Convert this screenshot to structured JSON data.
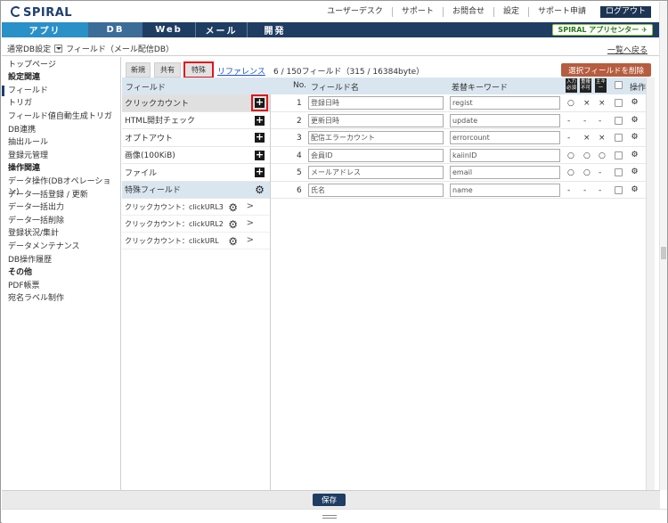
{
  "header": {
    "logo": "SPIRAL",
    "links": [
      "ユーザーデスク",
      "サポート",
      "お問合せ",
      "設定",
      "サポート申請",
      "ログアウト"
    ]
  },
  "tabs": [
    "アプリ",
    "DB",
    "Web",
    "メール",
    "開発"
  ],
  "app_center": "SPIRAL アプリセンター",
  "subheader": {
    "db_label": "通常DB設定",
    "db_name": "フィールド（メール配信DB）",
    "back_link": "一覧へ戻る"
  },
  "sidebar": {
    "items": [
      {
        "label": "トップページ",
        "type": "item"
      },
      {
        "label": "設定関連",
        "type": "head"
      },
      {
        "label": "フィールド",
        "type": "active"
      },
      {
        "label": "トリガ",
        "type": "item"
      },
      {
        "label": "フィールド値自動生成トリガ",
        "type": "item"
      },
      {
        "label": "DB連携",
        "type": "item"
      },
      {
        "label": "抽出ルール",
        "type": "item"
      },
      {
        "label": "登録元管理",
        "type": "item"
      },
      {
        "label": "操作関連",
        "type": "head"
      },
      {
        "label": "データ操作(DBオペレーション)",
        "type": "item"
      },
      {
        "label": "データ一括登録 / 更新",
        "type": "item"
      },
      {
        "label": "データ一括出力",
        "type": "item"
      },
      {
        "label": "データ一括削除",
        "type": "item"
      },
      {
        "label": "登録状況/集計",
        "type": "item"
      },
      {
        "label": "データメンテナンス",
        "type": "item"
      },
      {
        "label": "DB操作履歴",
        "type": "item"
      },
      {
        "label": "その他",
        "type": "head"
      },
      {
        "label": "PDF帳票",
        "type": "item"
      },
      {
        "label": "宛名ラベル制作",
        "type": "item"
      }
    ]
  },
  "subtabs": {
    "new": "新規",
    "shared": "共有",
    "special": "特殊",
    "reference": "リファレンス",
    "count": "6 / 150フィールド（315 / 16384byte）",
    "delete_button": "選択フィールドを削除"
  },
  "columns": {
    "field": "フィールド",
    "no": "No.",
    "field_name": "フィールド名",
    "keyword": "差替キーワード",
    "required_icon": "入力必須",
    "duplicate_icon": "重複不可",
    "key_icon": "主キー",
    "operation": "操作"
  },
  "field_types": [
    {
      "label": "クリックカウント",
      "highlight": true,
      "boxed": true
    },
    {
      "label": "HTML開封チェック",
      "highlight": false,
      "boxed": false
    },
    {
      "label": "オプトアウト",
      "highlight": false,
      "boxed": false
    },
    {
      "label": "画像(100KiB)",
      "highlight": false,
      "boxed": false
    },
    {
      "label": "ファイル",
      "highlight": false,
      "boxed": false
    }
  ],
  "special_header": "特殊フィールド",
  "special_fields": [
    "クリックカウント：clickURL3",
    "クリックカウント：clickURL2",
    "クリックカウント：clickURL"
  ],
  "fields": [
    {
      "no": "1",
      "name": "登録日時",
      "keyword": "regist",
      "req": "○",
      "dup": "×",
      "key": "×"
    },
    {
      "no": "2",
      "name": "更新日時",
      "keyword": "update",
      "req": "-",
      "dup": "-",
      "key": "-"
    },
    {
      "no": "3",
      "name": "配信エラーカウント",
      "keyword": "errorcount",
      "req": "-",
      "dup": "×",
      "key": "×"
    },
    {
      "no": "4",
      "name": "会員ID",
      "keyword": "kaiinID",
      "req": "○",
      "dup": "○",
      "key": "○"
    },
    {
      "no": "5",
      "name": "メールアドレス",
      "keyword": "email",
      "req": "○",
      "dup": "○",
      "key": "-"
    },
    {
      "no": "6",
      "name": "氏名",
      "keyword": "name",
      "req": "-",
      "dup": "-",
      "key": "-"
    }
  ],
  "save_button": "保存"
}
